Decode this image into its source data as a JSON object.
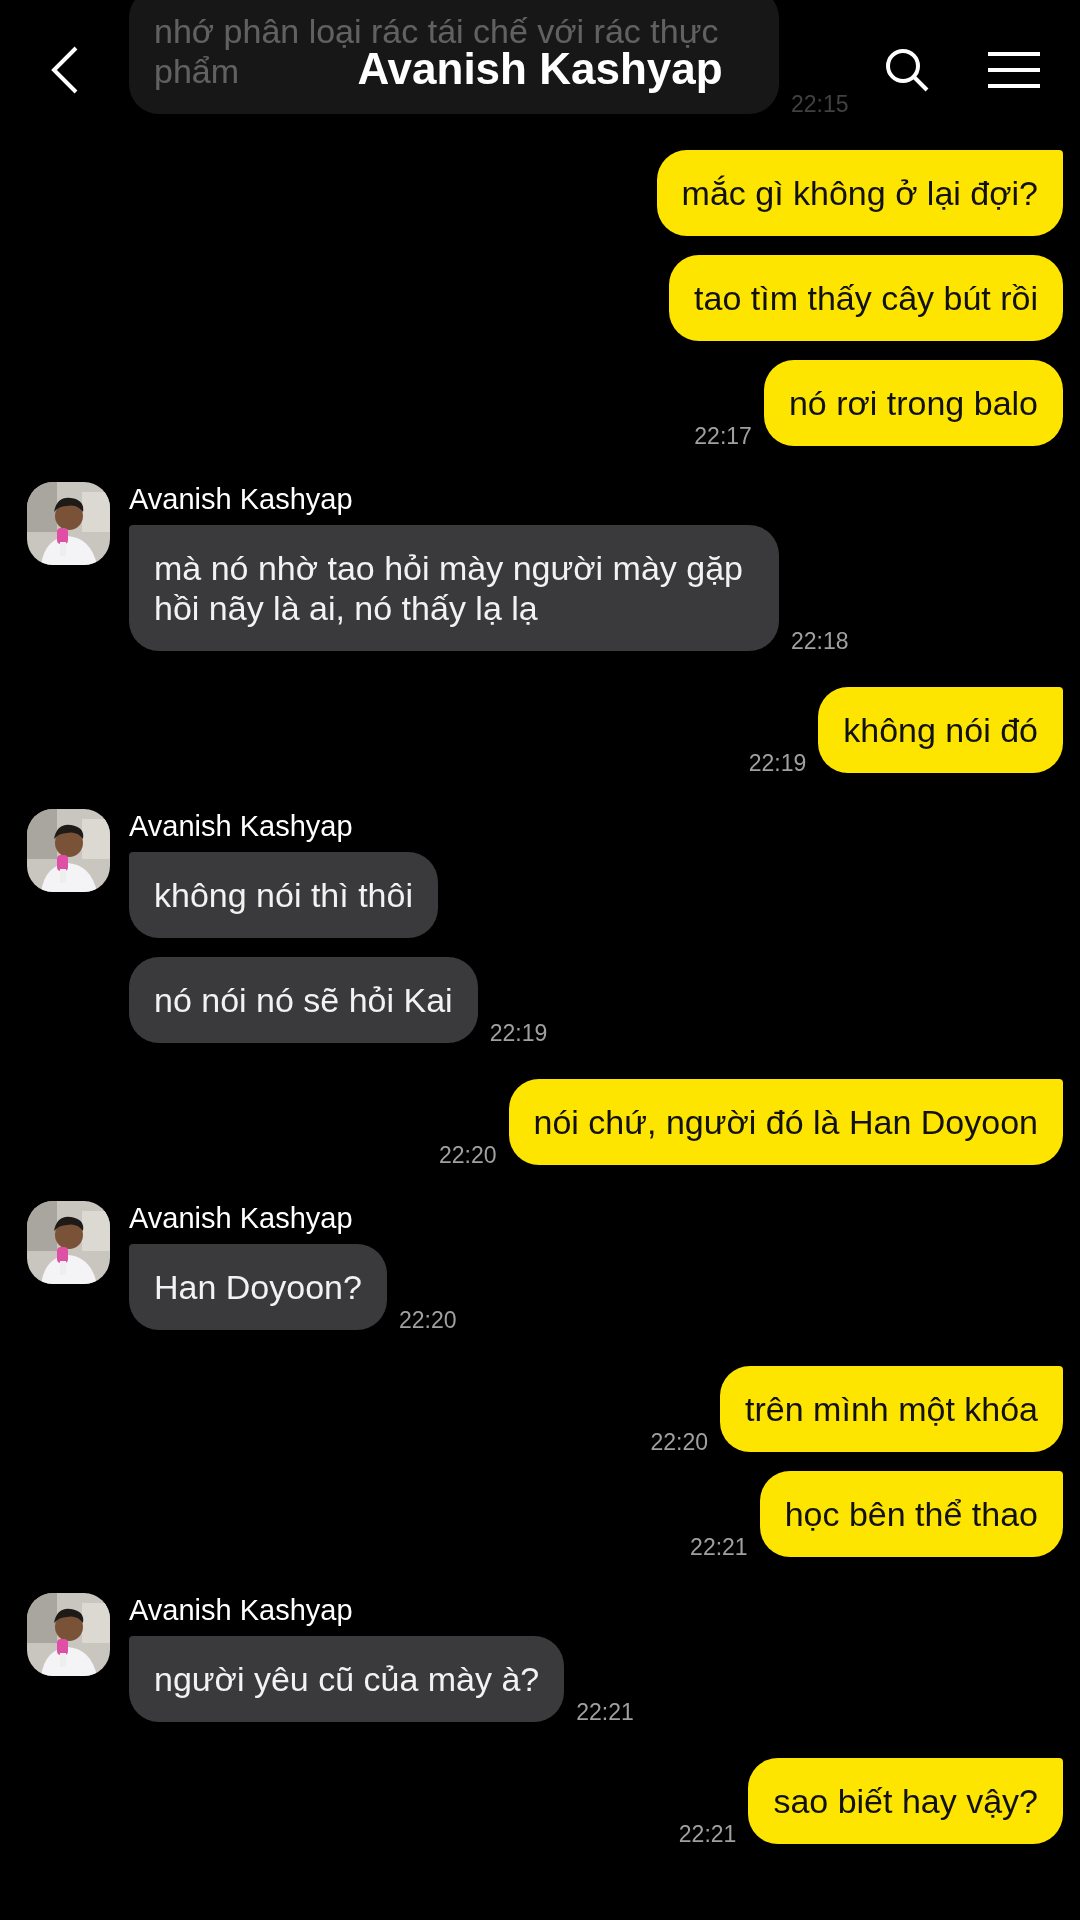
{
  "header": {
    "title": "Avanish Kashyap"
  },
  "groups": [
    {
      "kind": "received",
      "messages": [
        {
          "text": "nhớ phân loại rác tái chế với rác thực phẩm",
          "time": "22:15",
          "tail": false
        }
      ]
    },
    {
      "kind": "sent",
      "messages": [
        {
          "text": "mắc gì không ở lại đợi?",
          "tail": true
        },
        {
          "text": "tao tìm thấy cây bút rồi",
          "tail": false
        },
        {
          "text": "nó rơi trong balo",
          "time": "22:17",
          "tail": false
        }
      ]
    },
    {
      "kind": "received",
      "name": "Avanish Kashyap",
      "messages": [
        {
          "text": "mà nó nhờ tao hỏi mày người mày gặp hồi nãy là ai, nó thấy lạ lạ",
          "time": "22:18",
          "tail": true
        }
      ]
    },
    {
      "kind": "sent",
      "messages": [
        {
          "text": "không nói đó",
          "time": "22:19",
          "tail": true
        }
      ]
    },
    {
      "kind": "received",
      "name": "Avanish Kashyap",
      "messages": [
        {
          "text": "không nói thì thôi",
          "tail": true
        },
        {
          "text": "nó nói nó sẽ hỏi Kai",
          "time": "22:19",
          "tail": false
        }
      ]
    },
    {
      "kind": "sent",
      "messages": [
        {
          "text": "nói chứ, người đó là Han Doyoon",
          "time": "22:20",
          "tail": true
        }
      ]
    },
    {
      "kind": "received",
      "name": "Avanish Kashyap",
      "messages": [
        {
          "text": "Han Doyoon?",
          "time": "22:20",
          "tail": true
        }
      ]
    },
    {
      "kind": "sent",
      "messages": [
        {
          "text": "trên mình một khóa",
          "time": "22:20",
          "tail": true
        },
        {
          "text": "học bên thể thao",
          "time": "22:21",
          "tail": true
        }
      ]
    },
    {
      "kind": "received",
      "name": "Avanish Kashyap",
      "messages": [
        {
          "text": "người yêu cũ của mày à?",
          "time": "22:21",
          "tail": true
        }
      ]
    },
    {
      "kind": "sent",
      "messages": [
        {
          "text": "sao biết hay vậy?",
          "time": "22:21",
          "tail": true
        }
      ]
    }
  ]
}
